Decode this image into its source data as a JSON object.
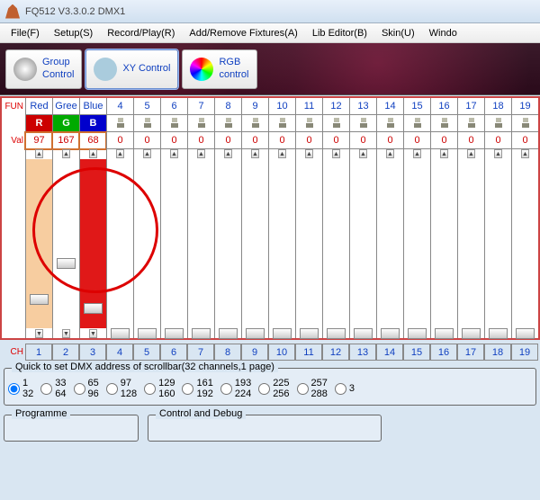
{
  "titlebar": {
    "text": "FQ512 V3.3.0.2      DMX1"
  },
  "menu": {
    "file": "File(F)",
    "setup": "Setup(S)",
    "record": "Record/Play(R)",
    "fixtures": "Add/Remove Fixtures(A)",
    "lib": "Lib Editor(B)",
    "skin": "Skin(U)",
    "window": "Windo"
  },
  "toolbar": {
    "group": "Group\nControl",
    "xy": "XY Control",
    "rgb": "RGB\ncontrol"
  },
  "grid": {
    "row_fun": "FUN",
    "row_val": "Val",
    "row_ch": "CH",
    "fun_labels": [
      "Red",
      "Gree",
      "Blue",
      "4",
      "5",
      "6",
      "7",
      "8",
      "9",
      "10",
      "11",
      "12",
      "13",
      "14",
      "15",
      "16",
      "17",
      "18",
      "19"
    ],
    "color_heads": [
      "R",
      "G",
      "B"
    ],
    "values": [
      "97",
      "167",
      "68",
      "0",
      "0",
      "0",
      "0",
      "0",
      "0",
      "0",
      "0",
      "0",
      "0",
      "0",
      "0",
      "0",
      "0",
      "0",
      "0"
    ],
    "channels": [
      "1",
      "2",
      "3",
      "4",
      "5",
      "6",
      "7",
      "8",
      "9",
      "10",
      "11",
      "12",
      "13",
      "14",
      "15",
      "16",
      "17",
      "18",
      "19"
    ]
  },
  "sliders": {
    "positions": [
      150,
      110,
      160,
      188,
      188,
      188,
      188,
      188,
      188,
      188,
      188,
      188,
      188,
      188,
      188,
      188,
      188,
      188,
      188
    ]
  },
  "quickset": {
    "label": "Quick to set DMX address of scrollbar(32 channels,1 page)",
    "ranges": [
      {
        "a": "1",
        "b": "32"
      },
      {
        "a": "33",
        "b": "64"
      },
      {
        "a": "65",
        "b": "96"
      },
      {
        "a": "97",
        "b": "128"
      },
      {
        "a": "129",
        "b": "160"
      },
      {
        "a": "161",
        "b": "192"
      },
      {
        "a": "193",
        "b": "224"
      },
      {
        "a": "225",
        "b": "256"
      },
      {
        "a": "257",
        "b": "288"
      },
      {
        "a": "3",
        "b": ""
      }
    ],
    "selected": 0
  },
  "panels": {
    "programme": "Programme",
    "control": "Control and Debug"
  }
}
